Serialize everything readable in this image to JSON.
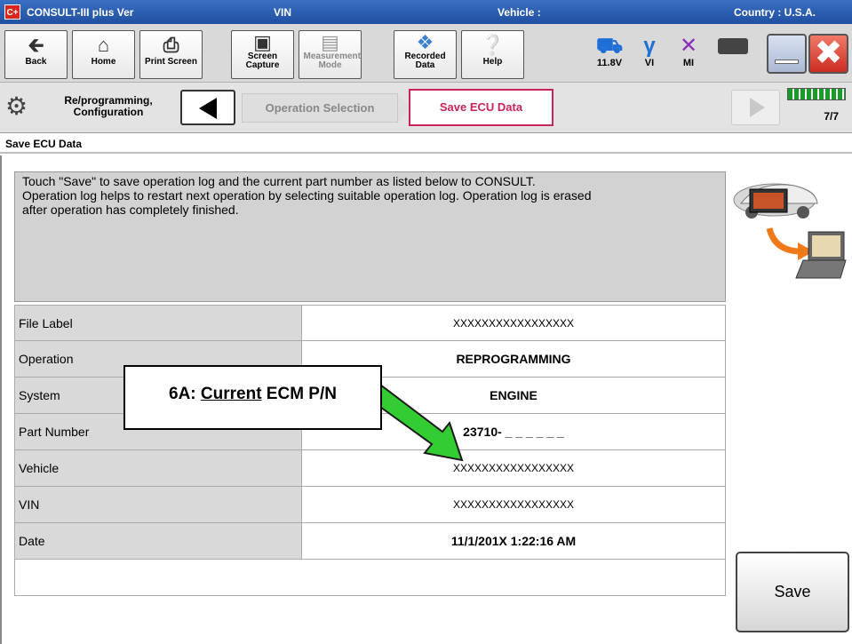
{
  "titlebar": {
    "app_title": "CONSULT-III plus  Ver",
    "app_icon": "C+",
    "vin_label": "VIN",
    "vehicle_label": "Vehicle :",
    "country": "Country : U.S.A."
  },
  "toolbar": {
    "buttons": [
      {
        "label": "Back",
        "icon": "back-arrow-icon"
      },
      {
        "label": "Home",
        "icon": "home-icon"
      },
      {
        "label": "Print Screen",
        "icon": "printer-icon"
      },
      {
        "label": "Screen Capture",
        "icon": "camera-icon"
      },
      {
        "label": "Measurement Mode",
        "icon": "measurement-icon"
      },
      {
        "label": "Recorded Data",
        "icon": "recorded-data-icon"
      },
      {
        "label": "Help",
        "icon": "help-icon"
      }
    ],
    "status": {
      "voltage": "11.8V",
      "vi": "VI",
      "mi": "MI"
    }
  },
  "navbar": {
    "title": "Re/programming, Configuration",
    "steps": {
      "previous": "Operation Selection",
      "current": "Save ECU Data"
    },
    "progress": {
      "count": "7/7",
      "fraction": 1.0
    }
  },
  "section_header": "Save ECU Data",
  "instruction": "Touch \"Save\" to save operation log and the current part number as listed below to CONSULT.\nOperation log helps to restart next operation by selecting suitable operation log. Operation log is erased\nafter operation has completely finished.",
  "table": {
    "rows": [
      {
        "label": "File Label",
        "value": "XXXXXXXXXXXXXXXXX"
      },
      {
        "label": "Operation",
        "value": "REPROGRAMMING"
      },
      {
        "label": "System",
        "value": "ENGINE"
      },
      {
        "label": "Part Number",
        "value": "23710- _ _ _ _ _ _"
      },
      {
        "label": "Vehicle",
        "value": "XXXXXXXXXXXXXXXXX"
      },
      {
        "label": "VIN",
        "value": "XXXXXXXXXXXXXXXXX"
      },
      {
        "label": "Date",
        "value": "11/1/201X 1:22:16 AM"
      }
    ]
  },
  "save_button": "Save",
  "annotation": {
    "prefix": "6A: ",
    "underlined": "Current",
    "suffix": " ECM P/N"
  },
  "colors": {
    "title_bar": "#1f4fa0",
    "current_step": "#c8235a",
    "annotation_arrow": "#33cc33",
    "progress_fill": "#1a9c2a"
  }
}
